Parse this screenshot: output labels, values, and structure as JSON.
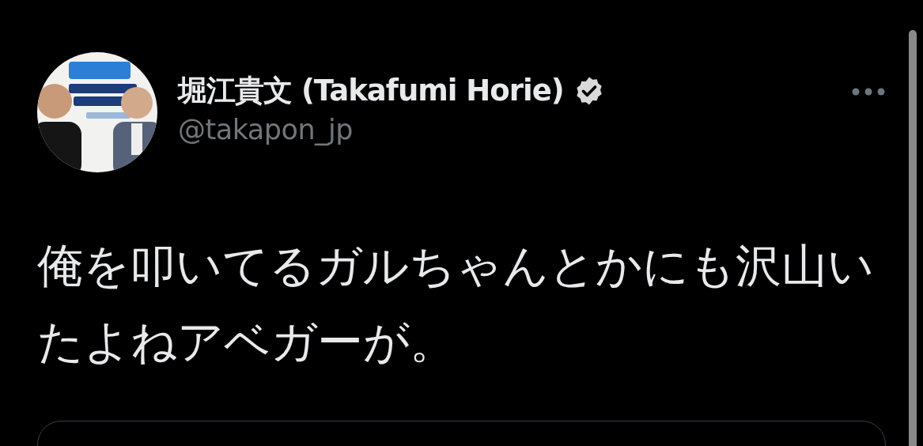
{
  "author": {
    "name": "堀江貴文 (Takafumi Horie)",
    "verified": true,
    "handle": "@takapon_jp"
  },
  "text": "俺を叩いてるガルちゃんとかにも沢山いたよねアベガーが。"
}
